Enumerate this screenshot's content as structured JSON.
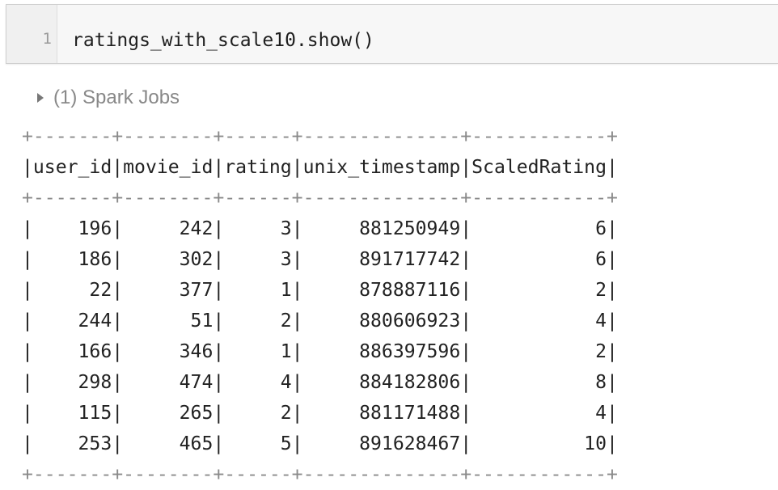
{
  "code_cell": {
    "line_number": "1",
    "code": "ratings_with_scale10.show()"
  },
  "spark_jobs": {
    "label": "(1) Spark Jobs"
  },
  "output": {
    "border": "+-------+--------+------+--------------+------------+",
    "header": "|user_id|movie_id|rating|unix_timestamp|ScaledRating|",
    "rows": [
      "|    196|     242|     3|     881250949|           6|",
      "|    186|     302|     3|     891717742|           6|",
      "|     22|     377|     1|     878887116|           2|",
      "|    244|      51|     2|     880606923|           4|",
      "|    166|     346|     1|     886397596|           2|",
      "|    298|     474|     4|     884182806|           8|",
      "|    115|     265|     2|     881171488|           4|",
      "|    253|     465|     5|     891628467|          10|"
    ],
    "table": {
      "columns": [
        "user_id",
        "movie_id",
        "rating",
        "unix_timestamp",
        "ScaledRating"
      ],
      "rows": [
        [
          "196",
          "242",
          "3",
          "881250949",
          "6"
        ],
        [
          "186",
          "302",
          "3",
          "891717742",
          "6"
        ],
        [
          "22",
          "377",
          "1",
          "878887116",
          "2"
        ],
        [
          "244",
          "51",
          "2",
          "880606923",
          "4"
        ],
        [
          "166",
          "346",
          "1",
          "886397596",
          "2"
        ],
        [
          "298",
          "474",
          "4",
          "884182806",
          "8"
        ],
        [
          "115",
          "265",
          "2",
          "881171488",
          "4"
        ],
        [
          "253",
          "465",
          "5",
          "891628467",
          "10"
        ]
      ]
    }
  }
}
